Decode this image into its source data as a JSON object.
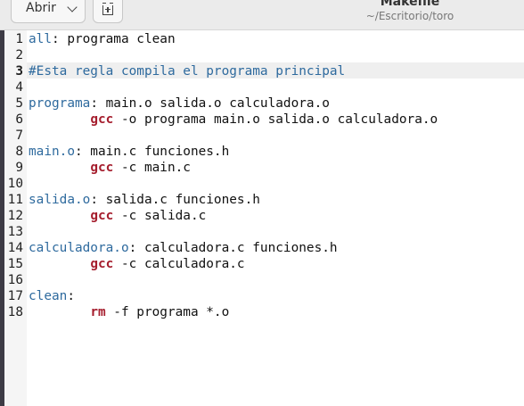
{
  "header": {
    "open_label": "Abrir",
    "title": "Makefile",
    "subtitle": "~/Escritorio/toro"
  },
  "editor": {
    "current_line": 3,
    "lines": [
      {
        "n": "1",
        "target": "all",
        "rest": ": programa clean"
      },
      {
        "n": "2"
      },
      {
        "n": "3",
        "comment": "#Esta regla compila el programa principal"
      },
      {
        "n": "4"
      },
      {
        "n": "5",
        "target": "programa",
        "rest": ": main.o salida.o calculadora.o"
      },
      {
        "n": "6",
        "indent": "        ",
        "cmd": "gcc",
        "rest": " -o programa main.o salida.o calculadora.o"
      },
      {
        "n": "7"
      },
      {
        "n": "8",
        "target": "main.o",
        "rest": ": main.c funciones.h"
      },
      {
        "n": "9",
        "indent": "        ",
        "cmd": "gcc",
        "rest": " -c main.c"
      },
      {
        "n": "10"
      },
      {
        "n": "11",
        "target": "salida.o",
        "rest": ": salida.c funciones.h"
      },
      {
        "n": "12",
        "indent": "        ",
        "cmd": "gcc",
        "rest": " -c salida.c"
      },
      {
        "n": "13"
      },
      {
        "n": "14",
        "target": "calculadora.o",
        "rest": ": calculadora.c funciones.h"
      },
      {
        "n": "15",
        "indent": "        ",
        "cmd": "gcc",
        "rest": " -c calculadora.c"
      },
      {
        "n": "16"
      },
      {
        "n": "17",
        "target": "clean",
        "rest": ":"
      },
      {
        "n": "18",
        "indent": "        ",
        "cmd": "rm",
        "rest": " -f programa *.o"
      }
    ]
  }
}
